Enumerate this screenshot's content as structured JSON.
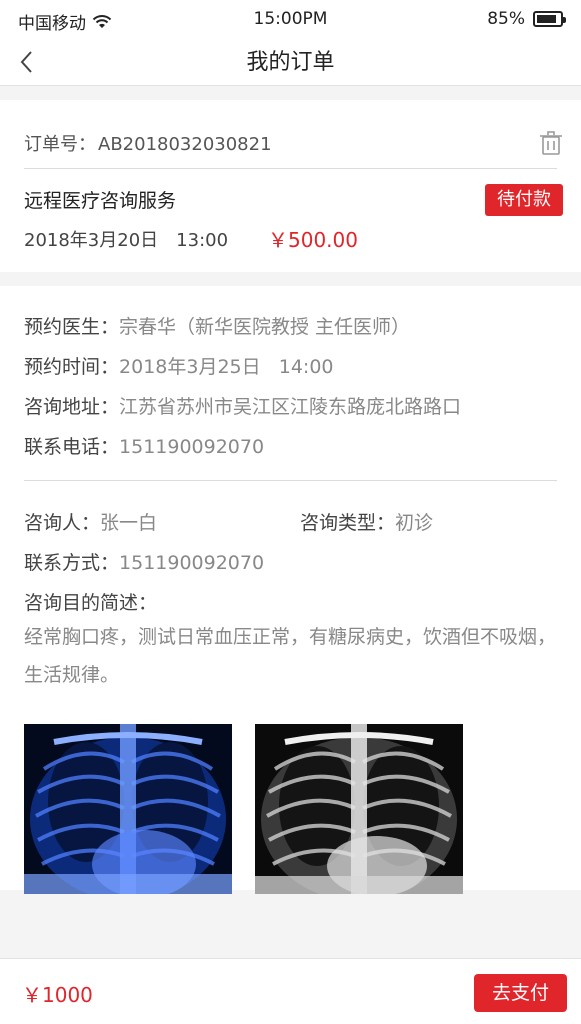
{
  "status_bar": {
    "carrier": "中国移动",
    "time": "15:00PM",
    "battery": "85%",
    "battery_level": 0.85
  },
  "header": {
    "title": "我的订单"
  },
  "order": {
    "number_label": "订单号：",
    "number": "AB2018032030821",
    "service_name": "远程医疗咨询服务",
    "status": "待付款",
    "date": "2018年3月20日",
    "time": "13:00",
    "price": "￥500.00"
  },
  "appointment": {
    "doctor_label": "预约医生：",
    "doctor": "宗春华（新华医院教授 主任医师）",
    "time_label": "预约时间：",
    "time": "2018年3月25日   14:00",
    "address_label": "咨询地址：",
    "address": "江苏省苏州市吴江区江陵东路庞北路路口",
    "phone_label": "联系电话：",
    "phone": "151190092070"
  },
  "consultant": {
    "person_label": "咨询人：",
    "person": "张一白",
    "type_label": "咨询类型：",
    "type": "初诊",
    "contact_label": "联系方式：",
    "contact": "151190092070",
    "purpose_label": "咨询目的简述：",
    "purpose": "经常胸口疼，测试日常血压正常，有糖尿病史，饮酒但不吸烟，生活规律。"
  },
  "images": {
    "items": [
      {
        "name": "chest-xray-blue",
        "tint": "#2a5cff"
      },
      {
        "name": "chest-xray-gray",
        "tint": "#d8d8d8"
      }
    ]
  },
  "footer": {
    "total": "￥1000",
    "pay_label": "去支付"
  },
  "colors": {
    "accent": "#e0262b"
  }
}
